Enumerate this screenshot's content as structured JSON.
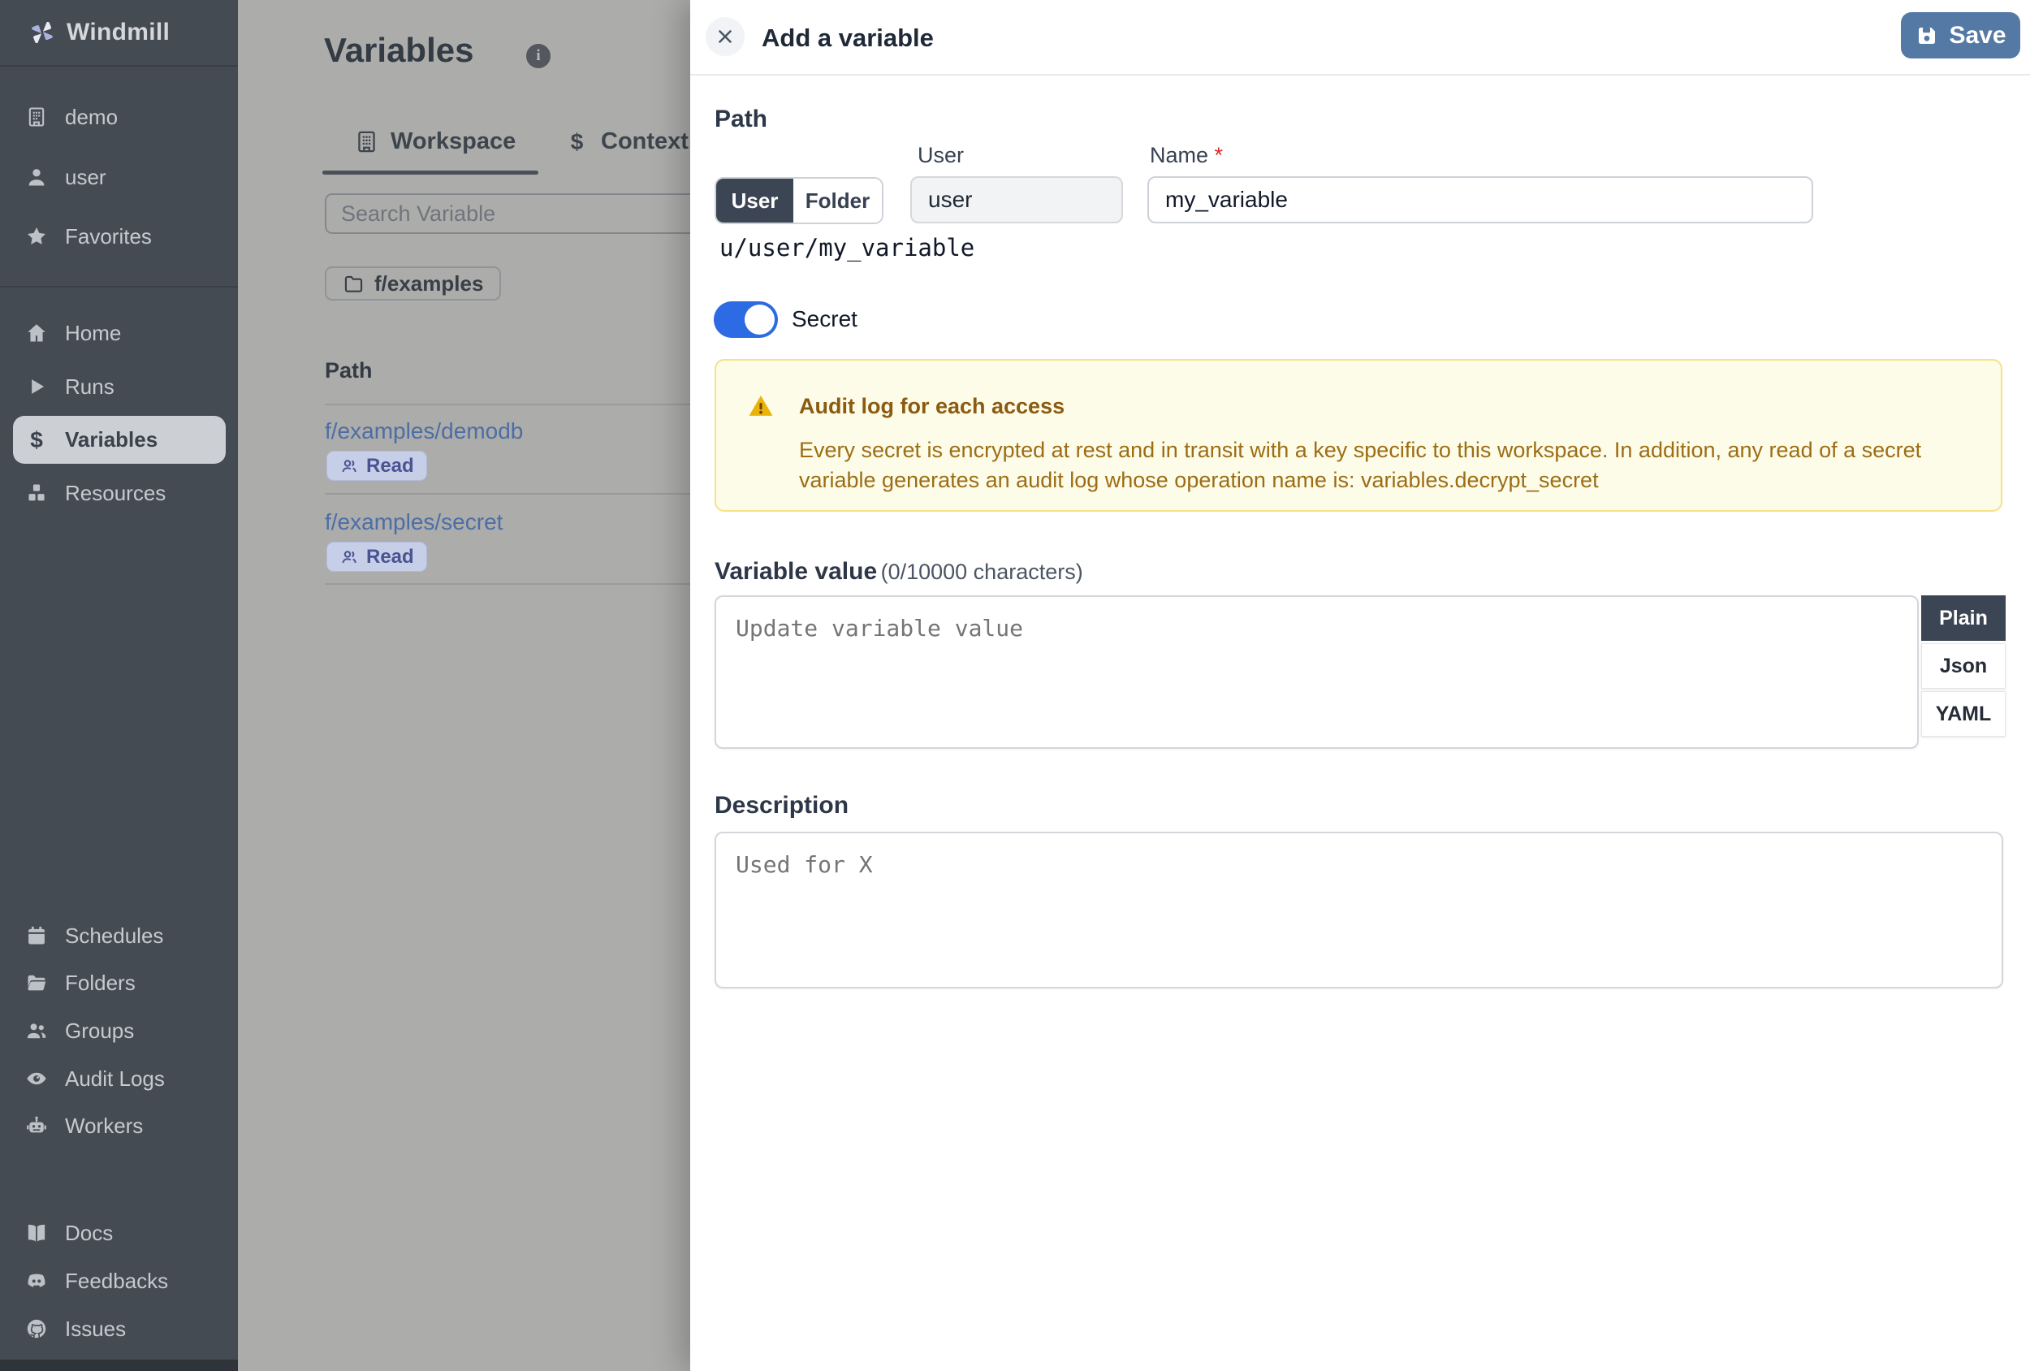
{
  "sidebar": {
    "logo": "Windmill",
    "workspace_items": [
      "demo",
      "user",
      "Favorites"
    ],
    "nav_main": [
      "Home",
      "Runs",
      "Variables",
      "Resources"
    ],
    "active_item": "Variables",
    "nav_admin": [
      "Schedules",
      "Folders",
      "Groups",
      "Audit Logs",
      "Workers"
    ],
    "nav_footer": [
      "Docs",
      "Feedbacks",
      "Issues"
    ]
  },
  "content": {
    "title": "Variables",
    "tabs": [
      {
        "label": "Workspace",
        "active": true
      },
      {
        "label": "Context",
        "active": false
      }
    ],
    "search_placeholder": "Search Variable",
    "folder_chip": "f/examples",
    "table": {
      "path_header": "Path",
      "rows": [
        {
          "path": "f/examples/demodb",
          "access": "Read"
        },
        {
          "path": "f/examples/secret",
          "access": "Read"
        }
      ]
    }
  },
  "drawer": {
    "title": "Add a variable",
    "save_label": "Save",
    "path_section": {
      "heading": "Path",
      "owner_toggle": {
        "user": "User",
        "folder": "Folder",
        "selected": "User"
      },
      "user_label": "User",
      "user_value": "user",
      "name_label": "Name",
      "name_required_mark": "*",
      "name_value": "my_variable",
      "full_path": "u/user/my_variable"
    },
    "secret_toggle": {
      "label": "Secret",
      "on": true
    },
    "warning": {
      "title": "Audit log for each access",
      "body": "Every secret is encrypted at rest and in transit with a key specific to this workspace. In addition, any read of a secret variable generates an audit log whose operation name is: variables.decrypt_secret"
    },
    "value_section": {
      "heading": "Variable value",
      "counter": "(0/10000 characters)",
      "placeholder": "Update variable value",
      "format_tabs": [
        "Plain",
        "Json",
        "YAML"
      ],
      "active_format": "Plain"
    },
    "description_section": {
      "heading": "Description",
      "placeholder": "Used for X"
    }
  },
  "colors": {
    "sidebar_bg": "#454b53",
    "sidebar_active_bg": "#ccd0d5",
    "save_button": "#5479a4",
    "secret_toggle_on": "#2c6be3",
    "link_blue": "#4c6ea6",
    "warning_bg": "#fdfce9",
    "warning_border": "#f5e285",
    "warning_text": "#9c6d14",
    "format_tab_active_bg": "#3c4553",
    "overlay_dim": "#acacaa"
  }
}
